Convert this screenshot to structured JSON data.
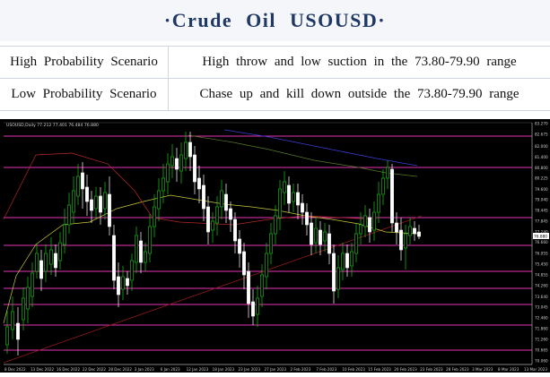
{
  "header": {
    "title": "·Crude Oil USOUSD·"
  },
  "scenarios": [
    {
      "label": "High Probability Scenario",
      "text": "High throw and low suction in the 73.80-79.90 range"
    },
    {
      "label": "Low Probability Scenario",
      "text": "Chase up and kill down outside the 73.80-79.90 range"
    }
  ],
  "chart": {
    "info": "USOUSD,Daily 77.212 77.401 76.484 76.880",
    "current_price": "76.880",
    "price_axis": [
      "83.270",
      "82.675",
      "82.000",
      "81.400",
      "80.800",
      "80.225",
      "79.600",
      "79.040",
      "78.445",
      "77.845",
      "77.240",
      "76.660",
      "76.055",
      "75.450",
      "74.855",
      "74.260",
      "73.640",
      "73.045",
      "72.460",
      "71.860",
      "71.260",
      "70.665",
      "70.060"
    ],
    "date_axis": [
      "8 Dec 2022",
      "13 Dec 2022",
      "16 Dec 2022",
      "22 Dec 2022",
      "28 Dec 2022",
      "3 Jan 2023",
      "6 Jan 2023",
      "12 Jan 2023",
      "18 Jan 2023",
      "23 Jan 2023",
      "27 Jan 2023",
      "2 Feb 2023",
      "7 Feb 2023",
      "10 Feb 2023",
      "15 Feb 2023",
      "20 Feb 2023",
      "23 Feb 2023",
      "28 Feb 2023",
      "3 Mar 2023",
      "8 Mar 2023",
      "13 Mar 2023"
    ],
    "colors": {
      "background": "#000000",
      "bull": "#19c819",
      "bear": "#ffffff",
      "level": "#e633b4",
      "ma_fast": "#c8c83c",
      "ma_slow": "#b42828",
      "ma_long": "#3c3cd2",
      "trend": "#8c1a1a"
    }
  }
}
